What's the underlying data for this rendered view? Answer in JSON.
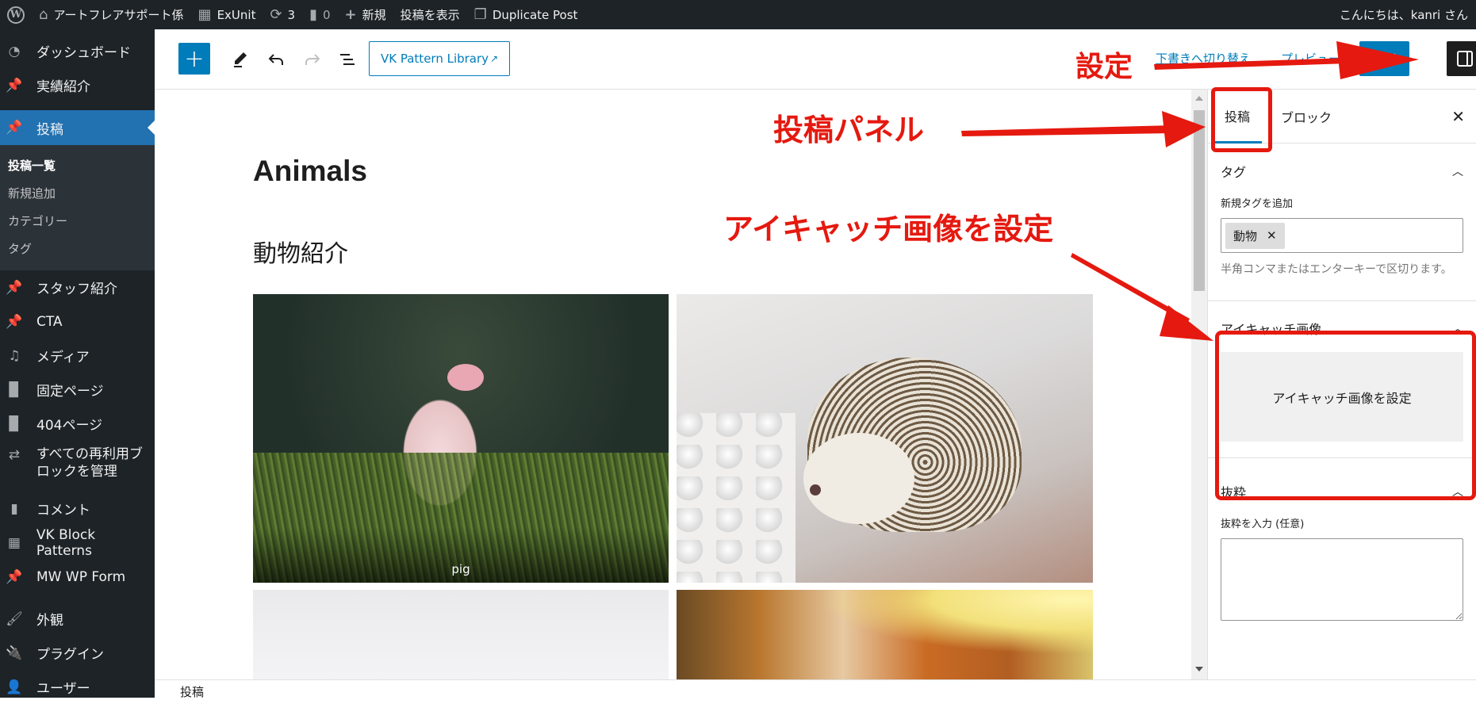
{
  "admin_bar": {
    "site_name": "アートフレアサポート係",
    "exunit": "ExUnit",
    "updates_count": "3",
    "comments_count": "0",
    "new_label": "新規",
    "view_post": "投稿を表示",
    "duplicate_post": "Duplicate Post",
    "greeting": "こんにちは、kanri さん"
  },
  "sidebar": {
    "items": [
      {
        "label": "ダッシュボード",
        "icon": "dashboard-icon"
      },
      {
        "label": "実績紹介",
        "icon": "pin-icon"
      },
      {
        "label": "投稿",
        "icon": "pin-icon",
        "active": true
      },
      {
        "label": "スタッフ紹介",
        "icon": "pin-icon"
      },
      {
        "label": "CTA",
        "icon": "pin-icon"
      },
      {
        "label": "メディア",
        "icon": "media-icon"
      },
      {
        "label": "固定ページ",
        "icon": "page-icon"
      },
      {
        "label": "404ページ",
        "icon": "page-icon"
      },
      {
        "label": "すべての再利用ブロックを管理",
        "icon": "reusable-block-icon"
      },
      {
        "label": "コメント",
        "icon": "comment-icon"
      },
      {
        "label": "VK Block Patterns",
        "icon": "grid-icon"
      },
      {
        "label": "MW WP Form",
        "icon": "pin-icon"
      },
      {
        "label": "外観",
        "icon": "brush-icon"
      },
      {
        "label": "プラグイン",
        "icon": "plugin-icon"
      },
      {
        "label": "ユーザー",
        "icon": "user-icon"
      }
    ],
    "submenu": [
      "投稿一覧",
      "新規追加",
      "カテゴリー",
      "タグ"
    ]
  },
  "toolbar": {
    "inserter": "+",
    "vk_pattern_library": "VK Pattern Library",
    "switch_to_draft": "下書きへ切り替え",
    "preview": "プレビュー",
    "publish": "更新"
  },
  "post": {
    "title": "Animals",
    "subheading": "動物紹介",
    "gallery": [
      {
        "alt": "pig",
        "caption": "pig"
      },
      {
        "alt": "hedgehog",
        "caption": ""
      },
      {
        "alt": "white background",
        "caption": ""
      },
      {
        "alt": "fox",
        "caption": ""
      }
    ]
  },
  "settings_panel": {
    "tabs": [
      "投稿",
      "ブロック"
    ],
    "active_tab": "投稿",
    "tags": {
      "heading": "タグ",
      "add_label": "新規タグを追加",
      "chips": [
        "動物"
      ],
      "help": "半角コンマまたはエンターキーで区切ります。"
    },
    "featured_image": {
      "heading": "アイキャッチ画像",
      "button": "アイキャッチ画像を設定"
    },
    "excerpt": {
      "heading": "抜粋",
      "label": "抜粋を入力 (任意)",
      "value": ""
    }
  },
  "footer": {
    "breadcrumb": "投稿"
  },
  "annotations": {
    "settings": "設定",
    "post_panel": "投稿パネル",
    "featured_image": "アイキャッチ画像を設定",
    "color": "#e5190f"
  },
  "colors": {
    "admin_dark": "#1d2327",
    "wp_blue": "#2271b1",
    "editor_blue": "#007cba"
  }
}
